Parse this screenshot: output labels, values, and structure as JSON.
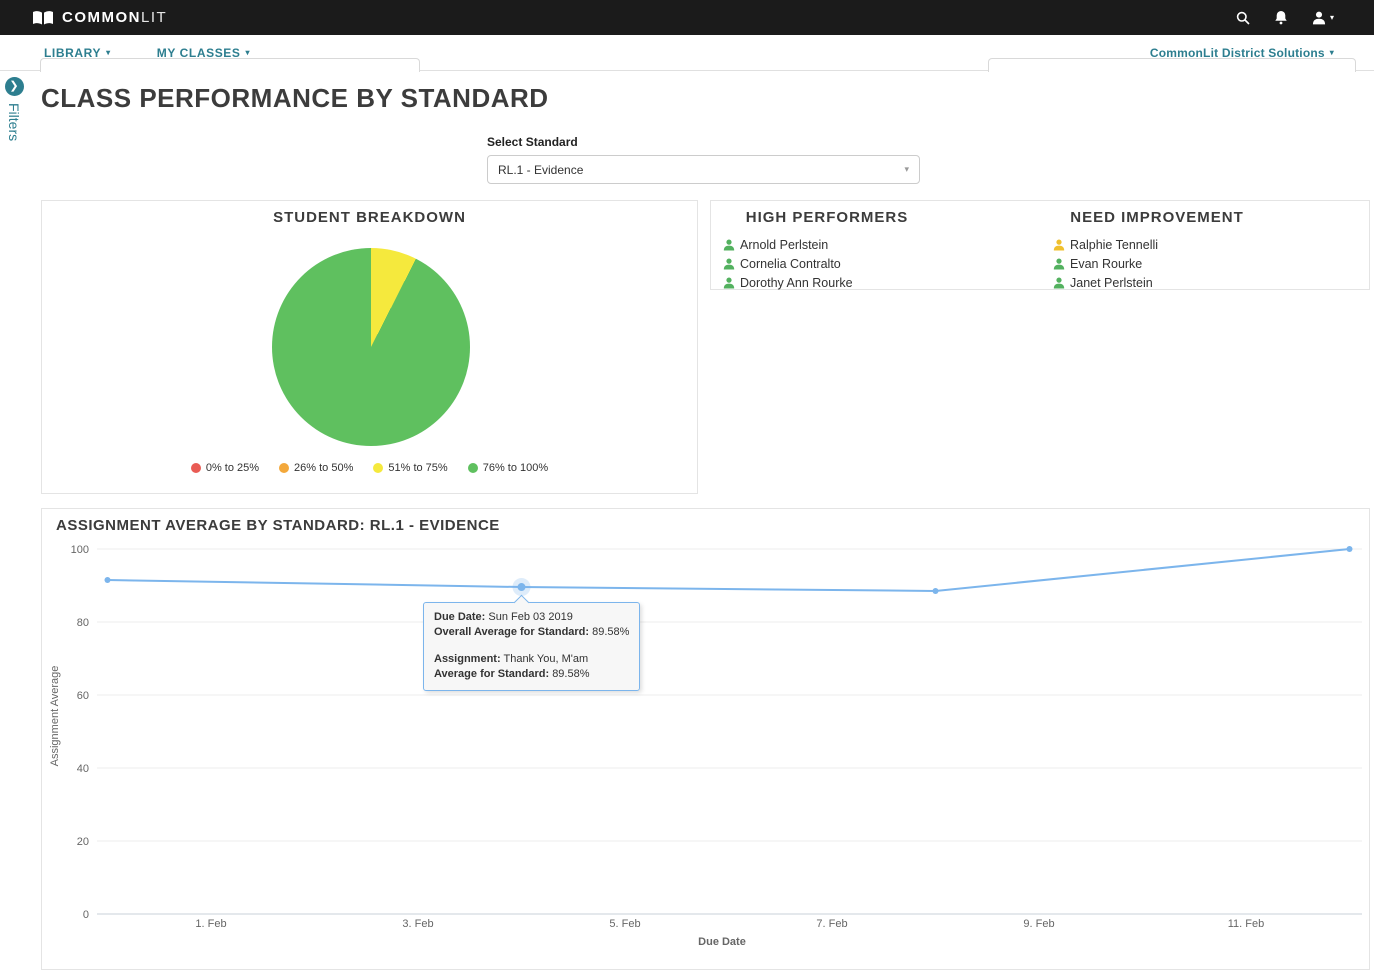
{
  "topbar": {
    "brand_bold": "COMMON",
    "brand_light": "LIT",
    "icons": [
      "book-logo",
      "search-icon",
      "bell-icon",
      "user-icon"
    ]
  },
  "subnav": {
    "library": "LIBRARY",
    "my_classes": "MY CLASSES",
    "district": "CommonLit District Solutions"
  },
  "filters": {
    "label": "Filters"
  },
  "page": {
    "title": "CLASS PERFORMANCE BY STANDARD",
    "select_label": "Select Standard",
    "select_value": "RL.1 - Evidence"
  },
  "performers": {
    "high": {
      "title": "HIGH PERFORMERS",
      "students": [
        {
          "name": "Arnold Perlstein",
          "color": "#53b15f"
        },
        {
          "name": "Cornelia Contralto",
          "color": "#53b15f"
        },
        {
          "name": "Dorothy Ann Rourke",
          "color": "#53b15f"
        }
      ]
    },
    "need": {
      "title": "NEED IMPROVEMENT",
      "students": [
        {
          "name": "Ralphie Tennelli",
          "color": "#f0c02e"
        },
        {
          "name": "Evan Rourke",
          "color": "#53b15f"
        },
        {
          "name": "Janet Perlstein",
          "color": "#53b15f"
        }
      ]
    }
  },
  "chart_data": [
    {
      "type": "pie",
      "title": "STUDENT BREAKDOWN",
      "legend_position": "bottom",
      "slices": [
        {
          "label": "0% to 25%",
          "value": 0,
          "color": "#e95b54"
        },
        {
          "label": "26% to 50%",
          "value": 0,
          "color": "#f3a83b"
        },
        {
          "label": "51% to 75%",
          "value": 7.5,
          "color": "#f5e93d"
        },
        {
          "label": "76% to 100%",
          "value": 92.5,
          "color": "#5fc05f"
        }
      ]
    },
    {
      "type": "line",
      "title": "ASSIGNMENT AVERAGE BY STANDARD: RL.1 - EVIDENCE",
      "xlabel": "Due Date",
      "ylabel": "Assignment Average",
      "ylim": [
        0,
        100
      ],
      "yticks": [
        0,
        20,
        40,
        60,
        80,
        100
      ],
      "xticks": [
        "1. Feb",
        "3. Feb",
        "5. Feb",
        "7. Feb",
        "9. Feb",
        "11. Feb"
      ],
      "grid": true,
      "legend_position": "none",
      "hover_point_index": 1,
      "series": [
        {
          "name": "Assignment Average",
          "color": "#7cb5ec",
          "points": [
            {
              "x": 0,
              "y": 91.5
            },
            {
              "x": 4,
              "y": 89.58
            },
            {
              "x": 8,
              "y": 88.5
            },
            {
              "x": 12,
              "y": 100
            }
          ]
        }
      ]
    }
  ],
  "tooltip": {
    "due_date_label": "Due Date:",
    "due_date": "Sun Feb 03 2019",
    "overall_label": "Overall Average for Standard:",
    "overall_value": "89.58%",
    "assignment_label": "Assignment:",
    "assignment_value": "Thank You, M'am",
    "average_label": "Average for Standard:",
    "average_value": "89.58%"
  }
}
